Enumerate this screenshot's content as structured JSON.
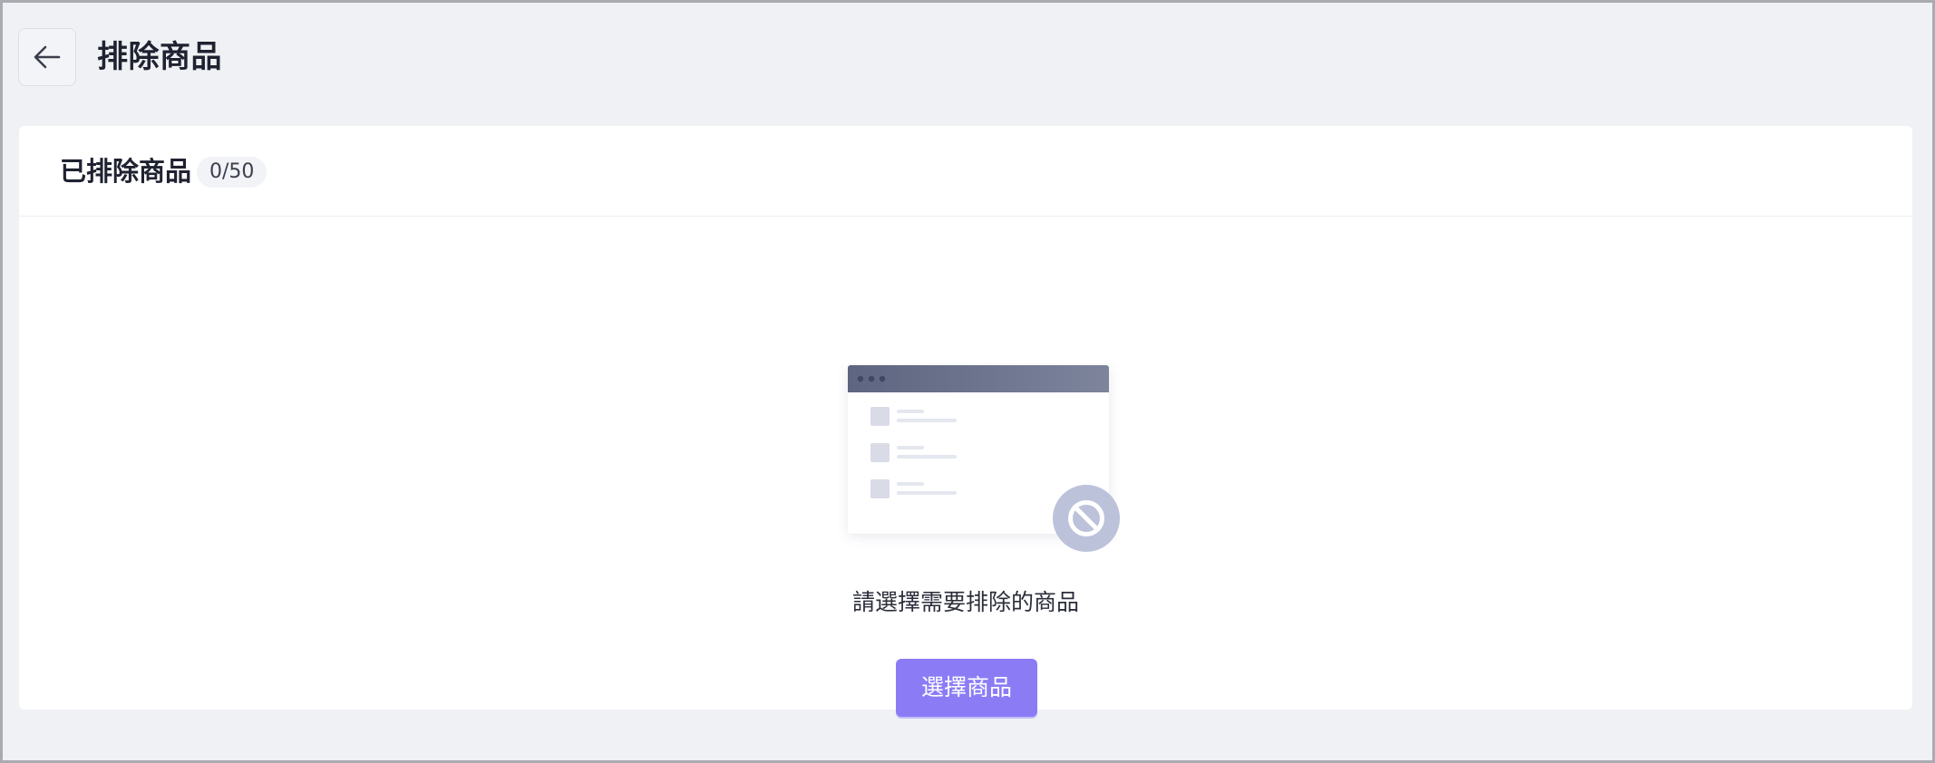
{
  "header": {
    "back_icon": "arrow-left-icon",
    "title": "排除商品"
  },
  "card": {
    "title": "已排除商品",
    "count": "0/50"
  },
  "empty_state": {
    "illustration_icon": "prohibited-list-illustration",
    "message": "請選擇需要排除的商品",
    "button_label": "選擇商品"
  },
  "colors": {
    "page_background": "#f0f1f4",
    "card_background": "#ffffff",
    "accent": "#8b7cf6",
    "title_text": "#1f2230"
  }
}
